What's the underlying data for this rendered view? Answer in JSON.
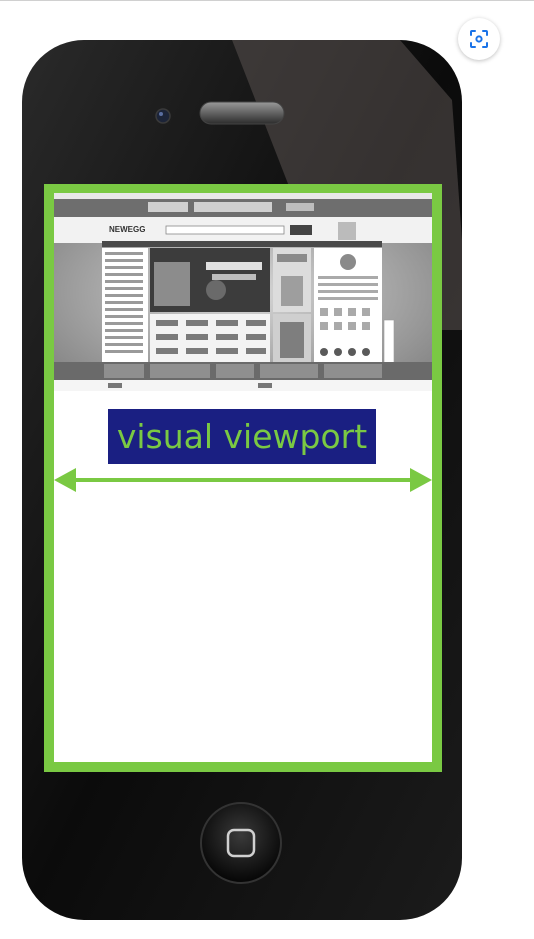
{
  "figure": {
    "label": "visual viewport",
    "accent_color": "#7ac943",
    "label_background": "#1a1f82",
    "phone_color": "#111111"
  },
  "controls": {
    "lens_icon": "lens-search-icon"
  },
  "website": {
    "logo_text": "NEWEGG"
  }
}
